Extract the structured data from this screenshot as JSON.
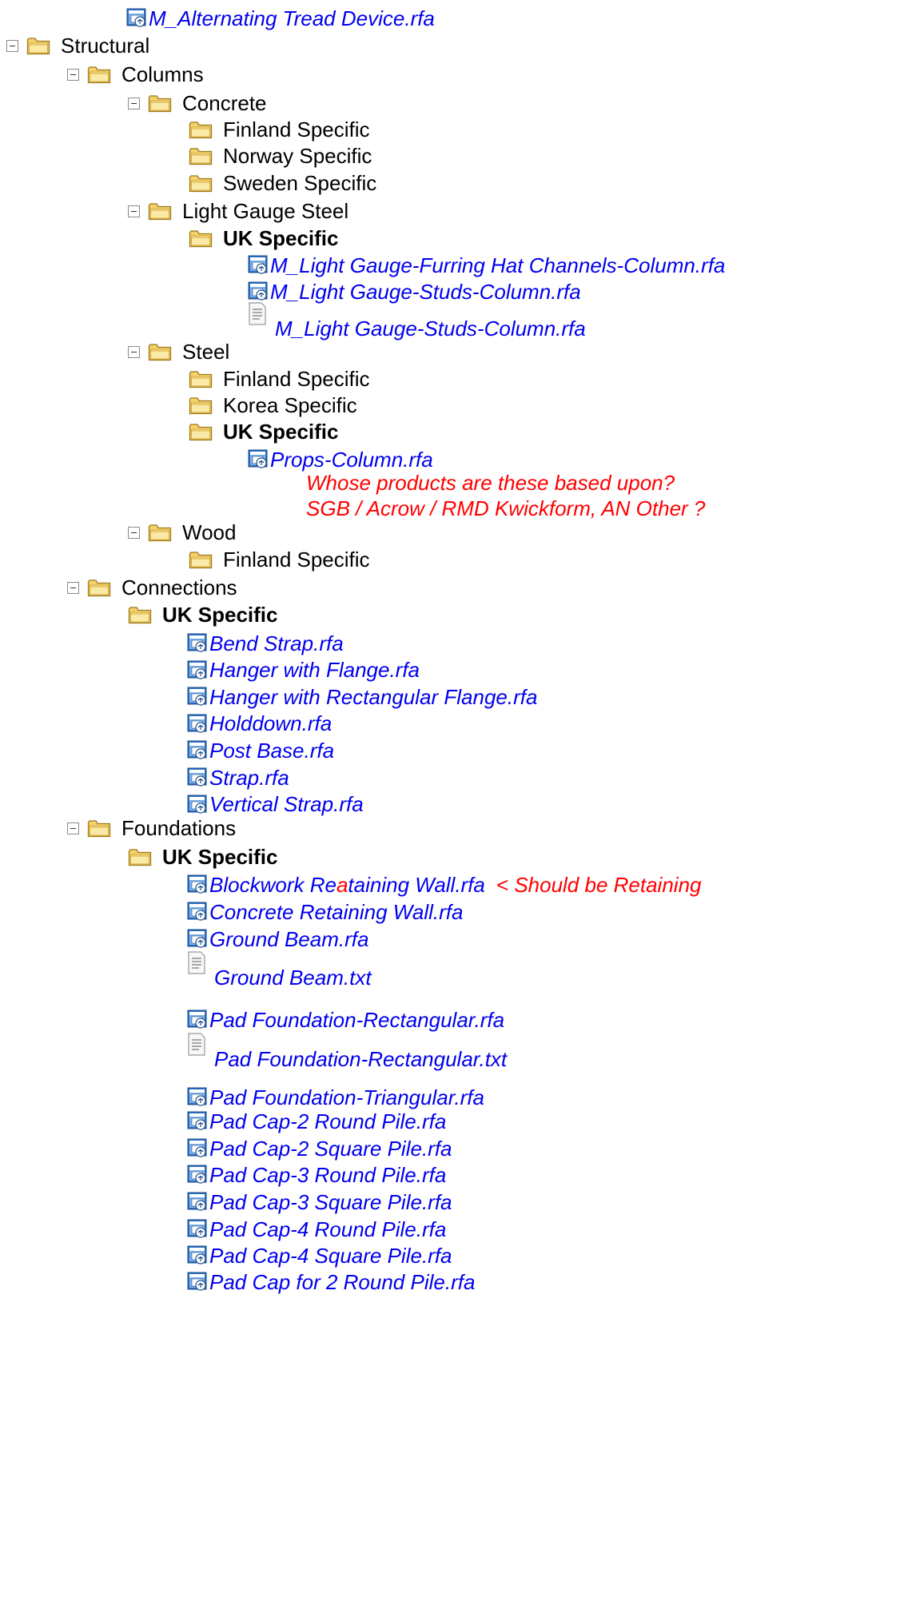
{
  "top_file": "M_Alternating Tread Device.rfa",
  "structural": "Structural",
  "columns": {
    "label": "Columns",
    "concrete": {
      "label": "Concrete",
      "children": [
        "Finland Specific",
        "Norway Specific",
        "Sweden Specific"
      ]
    },
    "light_gauge": {
      "label": "Light Gauge Steel",
      "uk": "UK Specific",
      "files": [
        "M_Light Gauge-Furring Hat Channels-Column.rfa",
        "M_Light Gauge-Studs-Column.rfa",
        "M_Light Gauge-Studs-Column.rfa"
      ]
    },
    "steel": {
      "label": "Steel",
      "children": [
        "Finland Specific",
        "Korea Specific"
      ],
      "uk": "UK Specific",
      "file": "Props-Column.rfa",
      "notes": [
        "Whose products are these based upon?",
        "SGB / Acrow / RMD Kwickform, AN Other ?"
      ]
    },
    "wood": {
      "label": "Wood",
      "children": [
        "Finland Specific"
      ]
    }
  },
  "connections": {
    "label": "Connections",
    "uk": "UK Specific",
    "files": [
      "Bend Strap.rfa",
      "Hanger with Flange.rfa",
      "Hanger with Rectangular Flange.rfa",
      "Holddown.rfa",
      "Post Base.rfa",
      "Strap.rfa",
      "Vertical Strap.rfa"
    ]
  },
  "foundations": {
    "label": "Foundations",
    "uk": "UK Specific",
    "blockwork": {
      "pre": "Blockwork Re",
      "red": "a",
      "post": "taining Wall.rfa",
      "note": "< Should be Retaining"
    },
    "files": [
      "Concrete Retaining Wall.rfa",
      "Ground Beam.rfa",
      "Ground Beam.txt",
      "Pad Foundation-Rectangular.rfa",
      "Pad Foundation-Rectangular.txt",
      "Pad Foundation-Triangular.rfa",
      "Pad Cap-2 Round Pile.rfa",
      "Pad Cap-2 Square Pile.rfa",
      "Pad Cap-3 Round Pile.rfa",
      "Pad Cap-3 Square Pile.rfa",
      "Pad Cap-4 Round Pile.rfa",
      "Pad Cap-4 Square Pile.rfa",
      "Pad Cap for 2 Round Pile.rfa"
    ]
  },
  "colors": {
    "link": "#0000ee",
    "note": "#ff0000",
    "folder": "#f2c63c"
  }
}
